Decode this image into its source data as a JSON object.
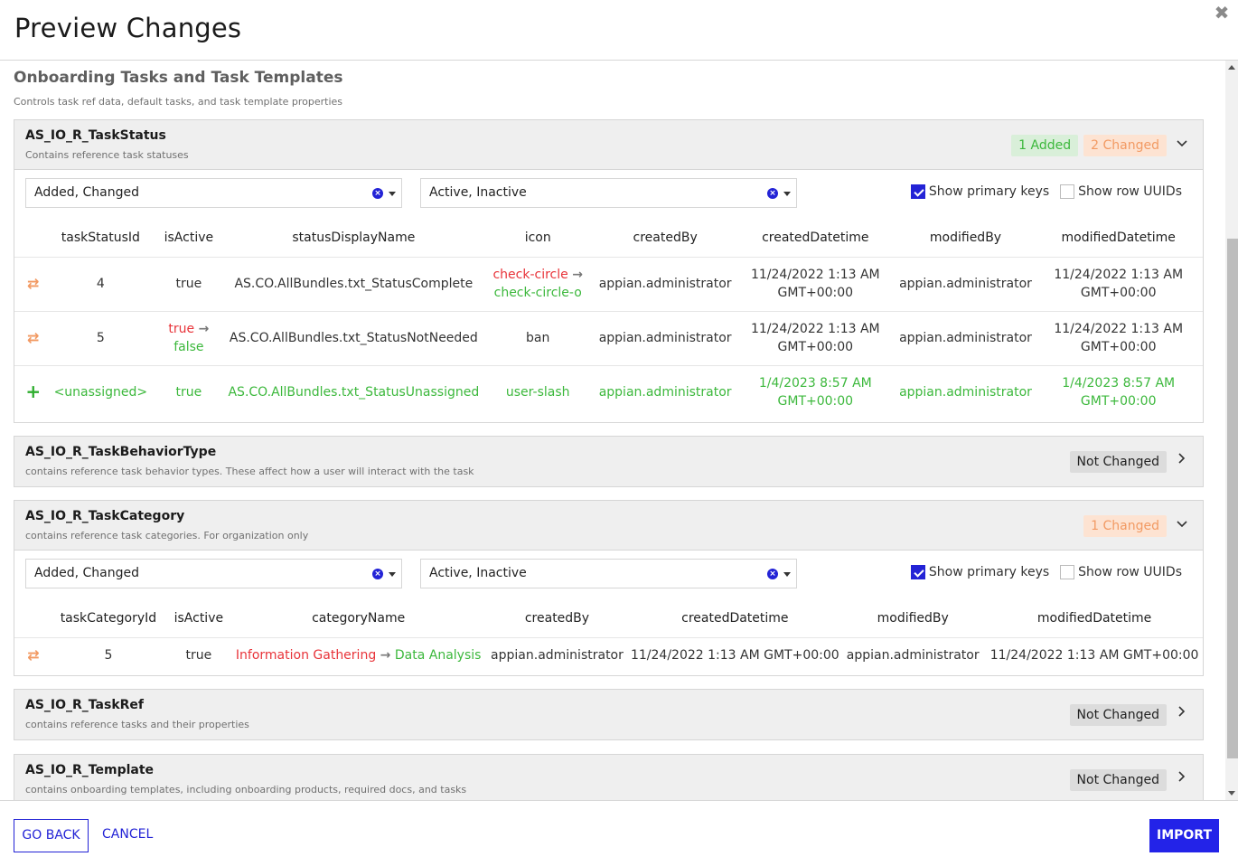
{
  "dialog": {
    "title": "Preview Changes",
    "close_icon": "close-icon"
  },
  "section": {
    "title": "Onboarding Tasks and Task Templates",
    "description": "Controls task ref data, default tasks, and task template properties"
  },
  "filters": {
    "change_type_value": "Added, Changed",
    "active_value": "Active, Inactive",
    "show_primary_keys_label": "Show primary keys",
    "show_primary_keys_checked": true,
    "show_row_uuids_label": "Show row UUIDs",
    "show_row_uuids_checked": false
  },
  "tables": [
    {
      "name": "AS_IO_R_TaskStatus",
      "description": "Contains reference task statuses",
      "expanded": true,
      "badges": [
        {
          "label": "1 Added",
          "type": "added"
        },
        {
          "label": "2 Changed",
          "type": "changed"
        }
      ],
      "columns": [
        "taskStatusId",
        "isActive",
        "statusDisplayName",
        "icon",
        "createdBy",
        "createdDatetime",
        "modifiedBy",
        "modifiedDatetime"
      ],
      "rows": [
        {
          "change": "changed",
          "taskStatusId": "4",
          "isActive": "true",
          "statusDisplayName": "AS.CO.AllBundles.txt_StatusComplete",
          "icon_old": "check-circle",
          "icon_new": "check-circle-o",
          "createdBy": "appian.administrator",
          "createdDatetime_line1": "11/24/2022 1:13 AM",
          "createdDatetime_line2": "GMT+00:00",
          "modifiedBy": "appian.administrator",
          "modifiedDatetime_line1": "11/24/2022 1:13 AM",
          "modifiedDatetime_line2": "GMT+00:00"
        },
        {
          "change": "changed",
          "taskStatusId": "5",
          "isActive_old": "true",
          "isActive_new": "false",
          "statusDisplayName": "AS.CO.AllBundles.txt_StatusNotNeeded",
          "icon": "ban",
          "createdBy": "appian.administrator",
          "createdDatetime_line1": "11/24/2022 1:13 AM",
          "createdDatetime_line2": "GMT+00:00",
          "modifiedBy": "appian.administrator",
          "modifiedDatetime_line1": "11/24/2022 1:13 AM",
          "modifiedDatetime_line2": "GMT+00:00"
        },
        {
          "change": "added",
          "taskStatusId": "<unassigned>",
          "isActive": "true",
          "statusDisplayName": "AS.CO.AllBundles.txt_StatusUnassigned",
          "icon": "user-slash",
          "createdBy": "appian.administrator",
          "createdDatetime_line1": "1/4/2023 8:57 AM",
          "createdDatetime_line2": "GMT+00:00",
          "modifiedBy": "appian.administrator",
          "modifiedDatetime_line1": "1/4/2023 8:57 AM",
          "modifiedDatetime_line2": "GMT+00:00"
        }
      ]
    },
    {
      "name": "AS_IO_R_TaskBehaviorType",
      "description": "contains reference task behavior types. These affect how a user will interact with the task",
      "expanded": false,
      "badges": [
        {
          "label": "Not Changed",
          "type": "none"
        }
      ]
    },
    {
      "name": "AS_IO_R_TaskCategory",
      "description": "contains reference task categories. For organization only",
      "expanded": true,
      "badges": [
        {
          "label": "1 Changed",
          "type": "changed"
        }
      ],
      "columns": [
        "taskCategoryId",
        "isActive",
        "categoryName",
        "createdBy",
        "createdDatetime",
        "modifiedBy",
        "modifiedDatetime"
      ],
      "rows": [
        {
          "change": "changed",
          "taskCategoryId": "5",
          "isActive": "true",
          "categoryName_old": "Information Gathering",
          "categoryName_new": "Data Analysis",
          "createdBy": "appian.administrator",
          "createdDatetime": "11/24/2022 1:13 AM GMT+00:00",
          "modifiedBy": "appian.administrator",
          "modifiedDatetime": "11/24/2022 1:13 AM GMT+00:00"
        }
      ]
    },
    {
      "name": "AS_IO_R_TaskRef",
      "description": "contains reference tasks and their properties",
      "expanded": false,
      "badges": [
        {
          "label": "Not Changed",
          "type": "none"
        }
      ]
    },
    {
      "name": "AS_IO_R_Template",
      "description": "contains onboarding templates, including onboarding products, required docs, and tasks",
      "expanded": false,
      "badges": [
        {
          "label": "Not Changed",
          "type": "none"
        }
      ]
    }
  ],
  "footer": {
    "go_back_label": "GO BACK",
    "cancel_label": "CANCEL",
    "import_label": "IMPORT"
  },
  "glyphs": {
    "arrow": "→",
    "changed": "⇄",
    "added": "+",
    "close": "✖",
    "chevron_down": "⌄",
    "chevron_right": "›",
    "clear": "×"
  },
  "colors": {
    "accent": "#2323e8",
    "old_value": "#e8343a",
    "new_value": "#3cb83c",
    "changed": "#f29a63"
  }
}
